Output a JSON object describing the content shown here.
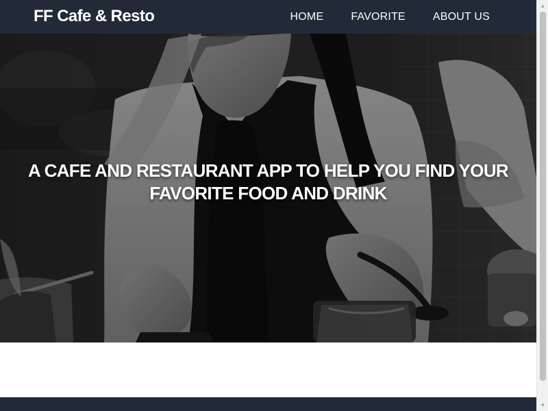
{
  "header": {
    "brand": "FF Cafe & Resto",
    "nav": [
      {
        "label": "HOME"
      },
      {
        "label": "FAVORITE"
      },
      {
        "label": "ABOUT US"
      }
    ]
  },
  "hero": {
    "title": "A CAFE AND RESTAURANT APP TO HELP YOU FIND YOUR FAVORITE FOOD AND DRINK"
  },
  "scrollbar": {
    "up_icon": "scroll-up-icon",
    "down_icon": "scroll-down-icon"
  }
}
